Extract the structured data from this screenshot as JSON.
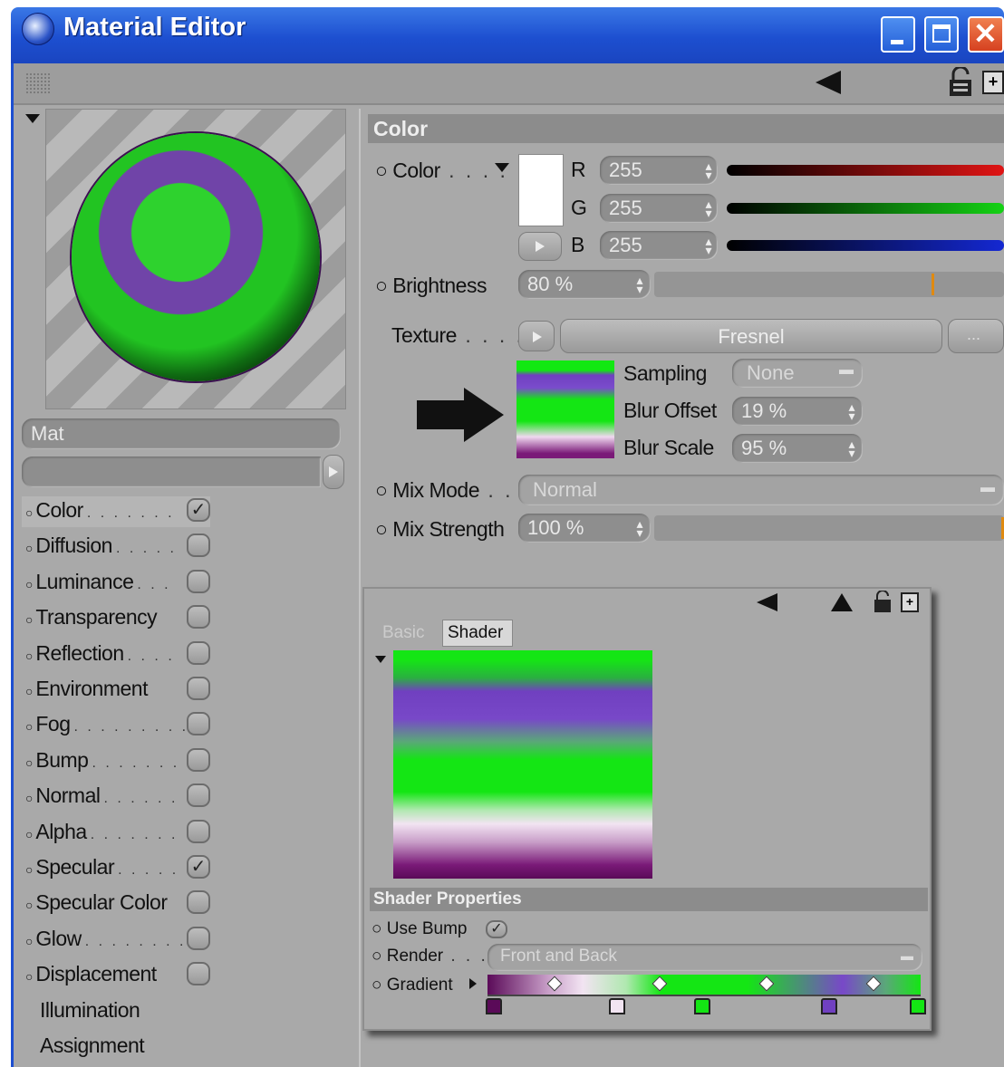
{
  "window": {
    "title": "Material Editor"
  },
  "material": {
    "name": "Mat"
  },
  "channels": [
    {
      "label": "Color",
      "enabled": true,
      "dots": ". . . . . . ."
    },
    {
      "label": "Diffusion",
      "enabled": false,
      "dots": ". . . . ."
    },
    {
      "label": "Luminance",
      "enabled": false,
      "dots": ". . ."
    },
    {
      "label": "Transparency",
      "enabled": false,
      "dots": ""
    },
    {
      "label": "Reflection",
      "enabled": false,
      "dots": ". . . ."
    },
    {
      "label": "Environment",
      "enabled": false,
      "dots": ""
    },
    {
      "label": "Fog",
      "enabled": false,
      "dots": ". . . . . . . . ."
    },
    {
      "label": "Bump",
      "enabled": false,
      "dots": ". . . . . . ."
    },
    {
      "label": "Normal",
      "enabled": false,
      "dots": ". . . . . ."
    },
    {
      "label": "Alpha",
      "enabled": false,
      "dots": ". . . . . . ."
    },
    {
      "label": "Specular",
      "enabled": true,
      "dots": ". . . . ."
    },
    {
      "label": "Specular Color",
      "enabled": false,
      "dots": ""
    },
    {
      "label": "Glow",
      "enabled": false,
      "dots": ". . . . . . . ."
    },
    {
      "label": "Displacement",
      "enabled": false,
      "dots": ""
    }
  ],
  "extra_items": [
    "Illumination",
    "Assignment"
  ],
  "color_panel": {
    "header": "Color",
    "color_label": "Color",
    "r_label": "R",
    "g_label": "G",
    "b_label": "B",
    "r": "255",
    "g": "255",
    "b": "255",
    "brightness_label": "Brightness",
    "brightness": "80 %",
    "brightness_fraction": 0.8,
    "texture_label": "Texture",
    "texture_value": "Fresnel",
    "sampling_label": "Sampling",
    "sampling_value": "None",
    "blur_offset_label": "Blur Offset",
    "blur_offset": "19 %",
    "blur_scale_label": "Blur Scale",
    "blur_scale": "95 %",
    "mix_mode_label": "Mix Mode",
    "mix_mode": "Normal",
    "mix_strength_label": "Mix Strength",
    "mix_strength": "100 %",
    "mix_strength_fraction": 1.0
  },
  "shader_window": {
    "tabs": [
      "Basic",
      "Shader"
    ],
    "active_tab": "Shader",
    "properties_header": "Shader Properties",
    "use_bump_label": "Use Bump",
    "use_bump": true,
    "render_label": "Render",
    "render_value": "Front and Back",
    "gradient_label": "Gradient"
  },
  "colors": {
    "titlebar": "#1d4fd0",
    "gradient_green": "#14e614",
    "gradient_purple": "#7040c0",
    "gradient_dark_purple": "#6a1068"
  }
}
